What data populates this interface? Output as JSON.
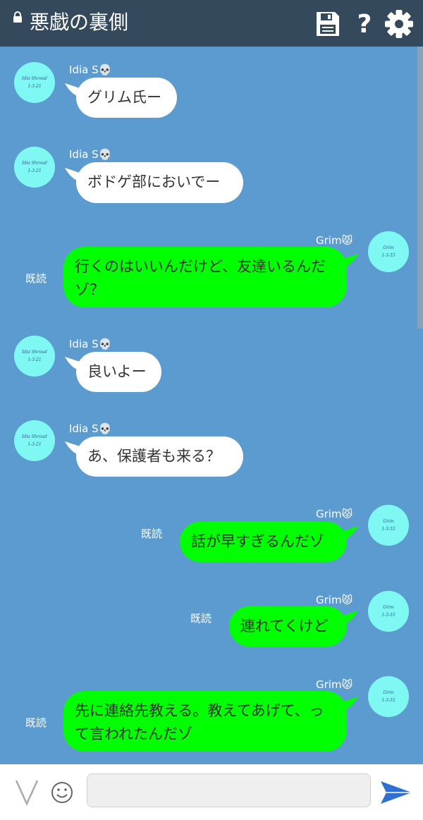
{
  "header": {
    "title": "悪戯の裏側",
    "icons": [
      "lock-icon",
      "save-icon",
      "help-icon",
      "gear-icon"
    ],
    "help_label": "?"
  },
  "colors": {
    "header_bg": "#34495c",
    "chat_bg": "#5b9bd0",
    "incoming_bubble": "#ffffff",
    "outgoing_bubble": "#00ff00",
    "avatar_bg": "#7ff8f4",
    "send_icon": "#2d6fd2"
  },
  "avatars": {
    "idia": {
      "line1": "Idia Shroud",
      "line2": "1-3-21"
    },
    "grim": {
      "line1": "Grim",
      "line2": "1-3-55"
    }
  },
  "messages": [
    {
      "side": "in",
      "sender": "Idia S💀",
      "text": "グリム氏ー"
    },
    {
      "side": "in",
      "sender": "Idia S💀",
      "text": "ボドゲ部においでー"
    },
    {
      "side": "out",
      "sender": "Grim😾",
      "text": "行くのはいいんだけど、友達いるんだゾ？",
      "read": "既読"
    },
    {
      "side": "in",
      "sender": "Idia S💀",
      "text": "良いよー"
    },
    {
      "side": "in",
      "sender": "Idia S💀",
      "text": "あ、保護者も来る？"
    },
    {
      "side": "out",
      "sender": "Grim😾",
      "text": "話が早すぎるんだゾ",
      "read": "既読"
    },
    {
      "side": "out",
      "sender": "Grim😾",
      "text": "連れてくけど",
      "read": "既読"
    },
    {
      "side": "out",
      "sender": "Grim😾",
      "text": "先に連絡先教える。教えてあげて、って言われたんだゾ",
      "read": "既読"
    }
  ],
  "input": {
    "value": "",
    "placeholder": ""
  }
}
